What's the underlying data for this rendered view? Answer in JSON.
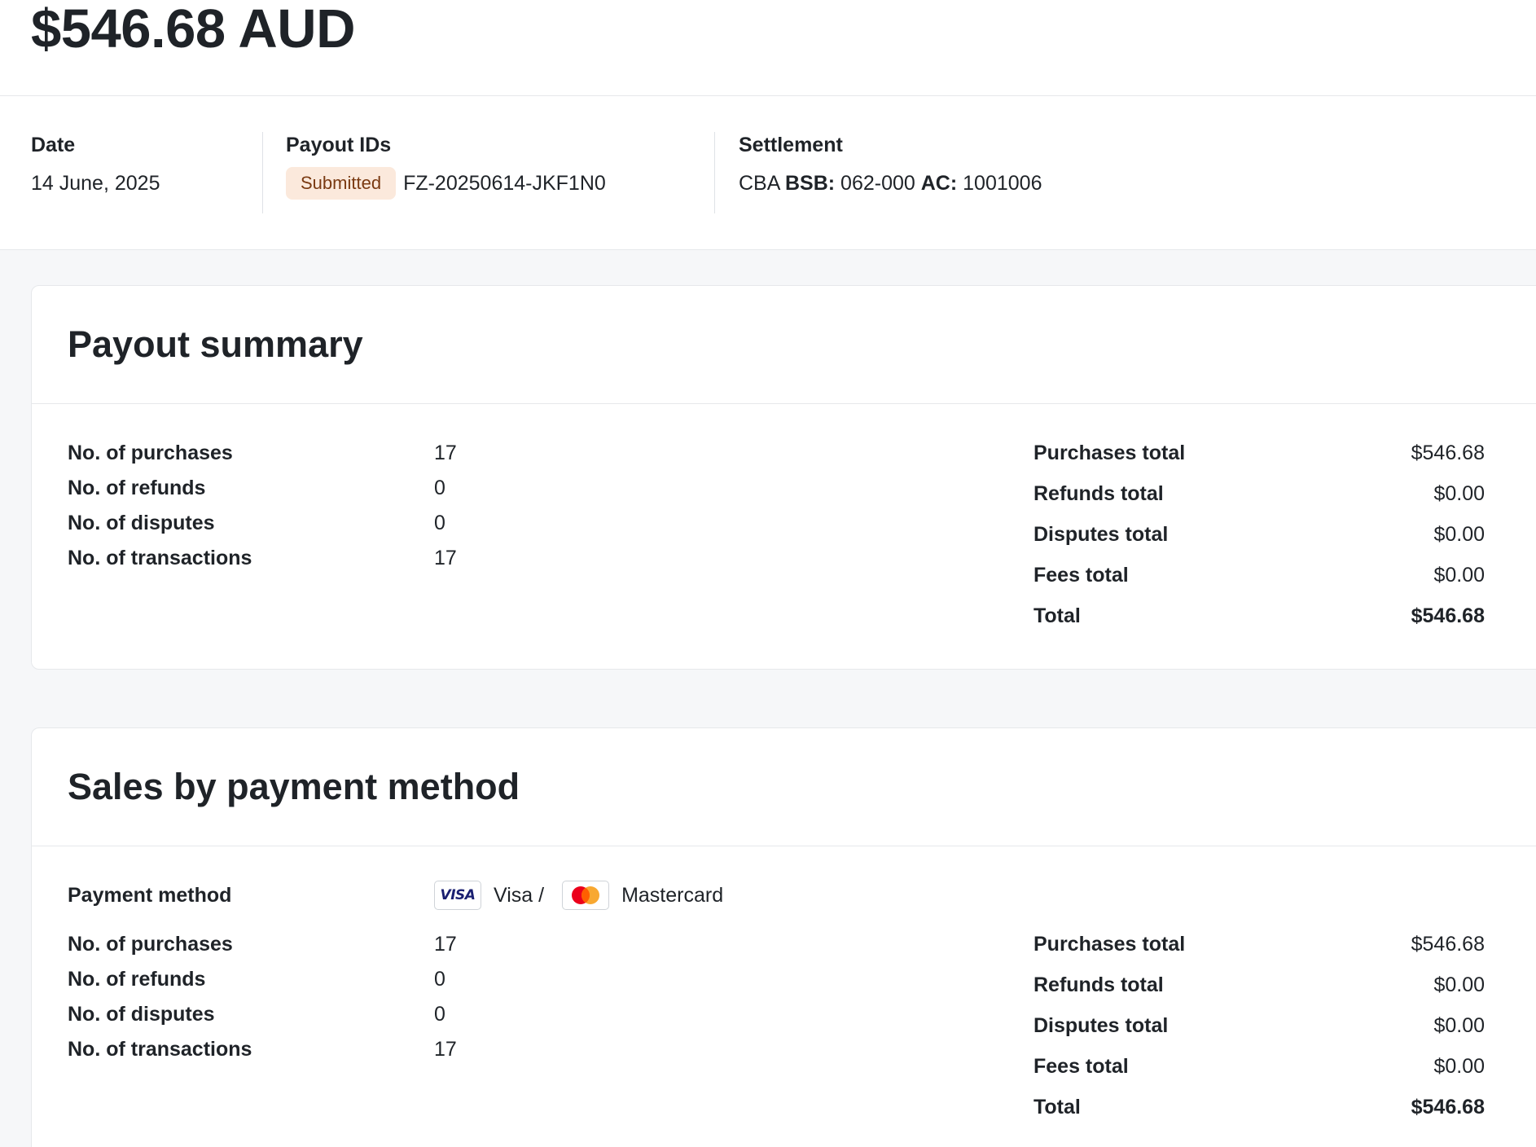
{
  "header": {
    "amount": "$546.68 AUD"
  },
  "meta": {
    "date_label": "Date",
    "date_value": "14 June, 2025",
    "payout_ids_label": "Payout IDs",
    "status_badge": "Submitted",
    "payout_id": "FZ-20250614-JKF1N0",
    "settlement_label": "Settlement",
    "settlement_bank": "CBA",
    "settlement_bsb_label": "BSB:",
    "settlement_bsb": "062-000",
    "settlement_ac_label": "AC:",
    "settlement_ac": "1001006"
  },
  "summary": {
    "title": "Payout summary",
    "counts": [
      {
        "label": "No. of purchases",
        "value": "17"
      },
      {
        "label": "No. of refunds",
        "value": "0"
      },
      {
        "label": "No. of disputes",
        "value": "0"
      },
      {
        "label": "No. of transactions",
        "value": "17"
      }
    ],
    "totals": [
      {
        "label": "Purchases total",
        "value": "$546.68"
      },
      {
        "label": "Refunds total",
        "value": "$0.00"
      },
      {
        "label": "Disputes total",
        "value": "$0.00"
      },
      {
        "label": "Fees total",
        "value": "$0.00"
      },
      {
        "label": "Total",
        "value": "$546.68"
      }
    ]
  },
  "sales": {
    "title": "Sales by payment method",
    "payment_method_label": "Payment method",
    "visa_logo_text": "VISA",
    "visa_label": "Visa /",
    "mastercard_label": "Mastercard",
    "counts": [
      {
        "label": "No. of purchases",
        "value": "17"
      },
      {
        "label": "No. of refunds",
        "value": "0"
      },
      {
        "label": "No. of disputes",
        "value": "0"
      },
      {
        "label": "No. of transactions",
        "value": "17"
      }
    ],
    "totals": [
      {
        "label": "Purchases total",
        "value": "$546.68"
      },
      {
        "label": "Refunds total",
        "value": "$0.00"
      },
      {
        "label": "Disputes total",
        "value": "$0.00"
      },
      {
        "label": "Fees total",
        "value": "$0.00"
      },
      {
        "label": "Total",
        "value": "$546.68"
      }
    ]
  },
  "colors": {
    "badge_bg": "#fbe9dc",
    "badge_text": "#7a3a12",
    "visa_blue": "#1a1f71",
    "mastercard_red": "#eb001b",
    "mastercard_orange": "#f79e1b"
  },
  "icons": [
    "visa-logo-icon",
    "mastercard-logo-icon"
  ]
}
